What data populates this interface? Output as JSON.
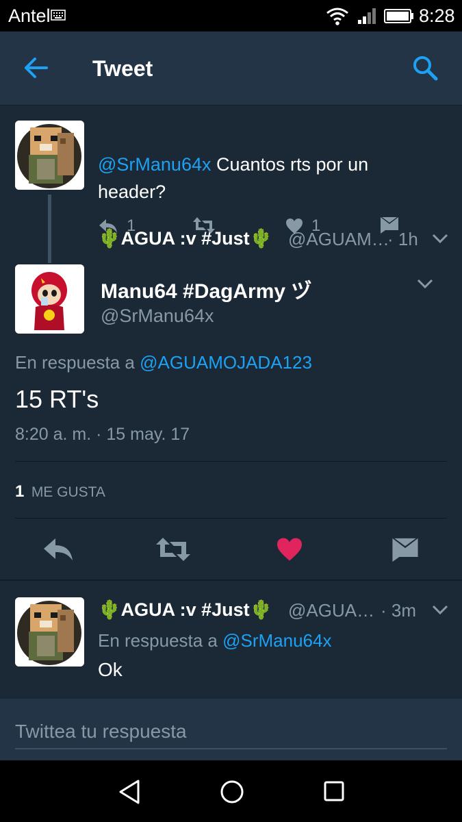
{
  "status_bar": {
    "carrier": "Antel",
    "time": "8:28"
  },
  "app_bar": {
    "title": "Tweet"
  },
  "tweet1": {
    "name": "🌵AGUA :v #Just🌵",
    "handle": "@AGUAM…",
    "time": "· 1h",
    "mention": "@SrManu64x",
    "text_line1": " Cuantos rts por un",
    "text_line2": "header?",
    "reply_count": "1",
    "like_count": "1"
  },
  "main_tweet": {
    "name": "Manu64 #DagArmy ヅ",
    "handle": "@SrManu64x",
    "in_reply_prefix": "En respuesta a ",
    "in_reply_to": "@AGUAMOJADA123",
    "text": "15 RT's",
    "timestamp": "8:20 a. m. · 15 may. 17",
    "likes_count": "1",
    "likes_label": "ME GUSTA"
  },
  "tweet3": {
    "name": "🌵AGUA :v #Just🌵",
    "handle": "@AGUA…",
    "time": "· 3m",
    "in_reply_prefix": "En respuesta a ",
    "in_reply_to": "@SrManu64x",
    "text": "Ok"
  },
  "reply_box": {
    "placeholder": "Twittea tu respuesta"
  },
  "colors": {
    "accent": "#1da1f2",
    "like": "#e0245e",
    "background": "#1b2836",
    "bar": "#243447",
    "secondary_text": "#8899a6"
  },
  "icons": [
    "keyboard-icon",
    "wifi-icon",
    "signal-icon",
    "battery-icon",
    "back-arrow-icon",
    "search-icon",
    "chevron-down-icon",
    "reply-icon",
    "retweet-icon",
    "heart-icon",
    "direct-message-icon",
    "nav-back-icon",
    "nav-home-icon",
    "nav-recents-icon"
  ]
}
